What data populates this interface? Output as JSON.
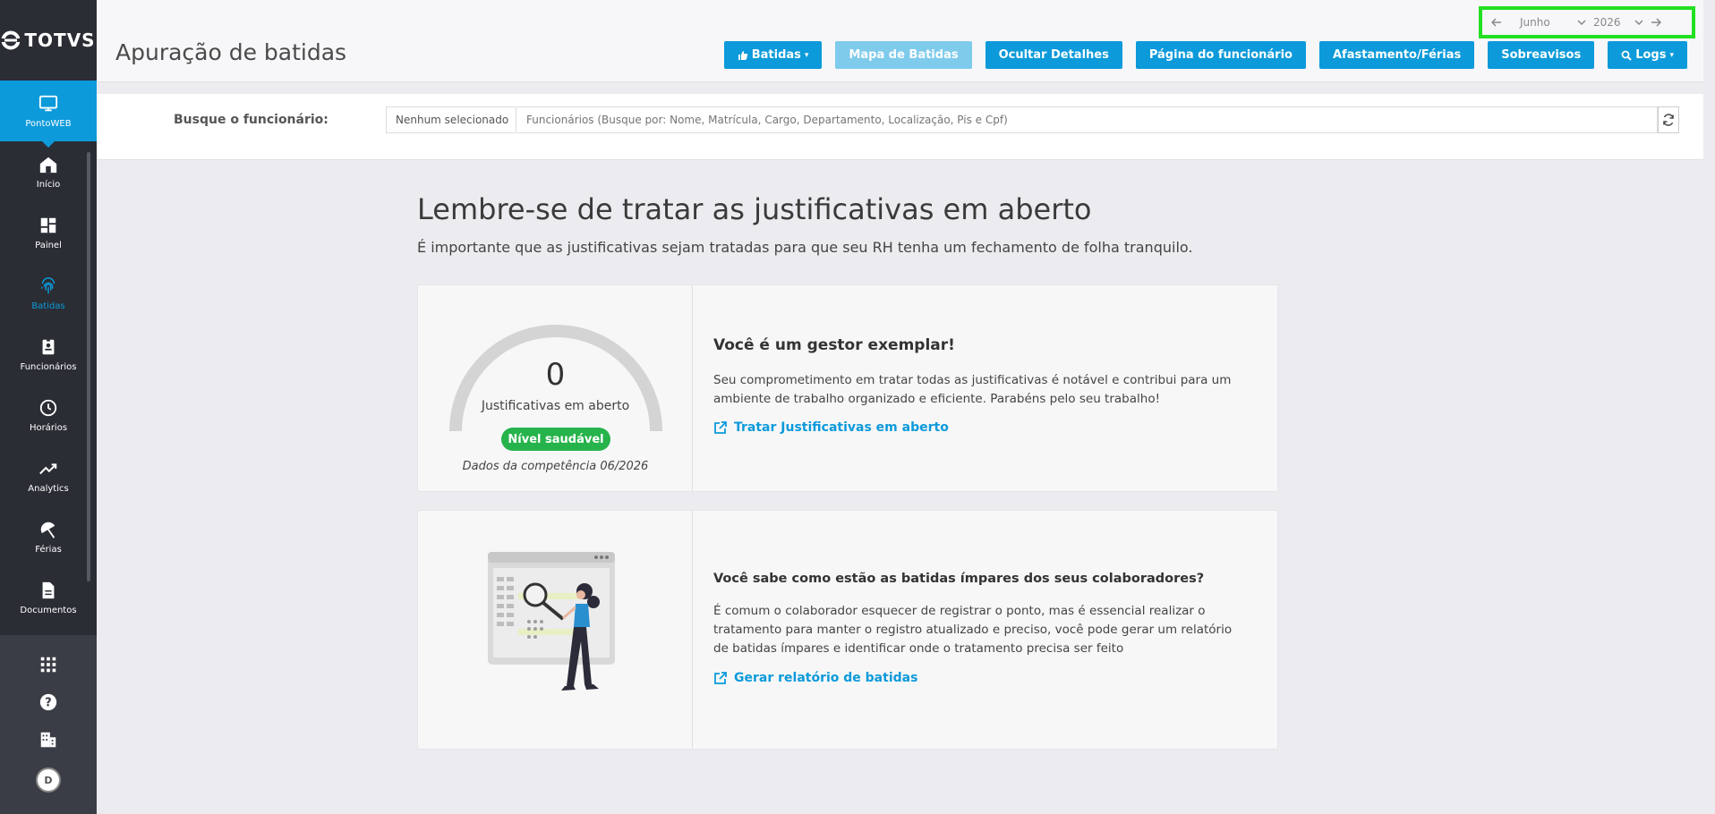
{
  "brand": {
    "name": "TOTVS"
  },
  "sidebar": {
    "items": [
      {
        "label": "PontoWEB",
        "icon": "monitor-icon"
      },
      {
        "label": "Início",
        "icon": "home-icon"
      },
      {
        "label": "Painel",
        "icon": "dashboard-icon"
      },
      {
        "label": "Batidas",
        "icon": "fingerprint-icon"
      },
      {
        "label": "Funcionários",
        "icon": "badge-icon"
      },
      {
        "label": "Horários",
        "icon": "clock-icon"
      },
      {
        "label": "Analytics",
        "icon": "trend-icon"
      },
      {
        "label": "Férias",
        "icon": "umbrella-icon"
      },
      {
        "label": "Documentos",
        "icon": "document-icon"
      }
    ],
    "avatar_initial": "D"
  },
  "header": {
    "title": "Apuração de batidas",
    "period": {
      "month": "Junho",
      "year": "2026"
    },
    "buttons": {
      "batidas": "Batidas",
      "mapa": "Mapa de Batidas",
      "ocultar": "Ocultar Detalhes",
      "pagina": "Página do funcionário",
      "afastamento": "Afastamento/Férias",
      "sobreavisos": "Sobreavisos",
      "logs": "Logs"
    }
  },
  "search": {
    "label": "Busque o funcionário:",
    "selected": "Nenhum selecionado",
    "placeholder": "Funcionários (Busque por: Nome, Matrícula, Cargo, Departamento, Localização, Pis e Cpf)"
  },
  "main": {
    "heading": "Lembre-se de tratar as justificativas em aberto",
    "subheading": "É importante que as justificativas sejam tratadas para que seu RH tenha um fechamento de folha tranquilo."
  },
  "card1": {
    "count": "0",
    "count_label": "Justificativas em aberto",
    "badge": "Nível saudável",
    "competencia": "Dados da competência 06/2026",
    "title": "Você é um gestor exemplar!",
    "text": "Seu comprometimento em tratar todas as justificativas é notável e contribui para um ambiente de trabalho organizado e eficiente. Parabéns pelo seu trabalho!",
    "link": "Tratar Justificativas em aberto"
  },
  "card2": {
    "title": "Você sabe como estão as batidas ímpares dos seus colaboradores?",
    "text": "É comum o colaborador esquecer de registrar o ponto, mas é essencial realizar o tratamento para manter o registro atualizado e preciso, você pode gerar um relatório de batidas ímpares e identificar onde o tratamento precisa ser feito",
    "link": "Gerar relatório de batidas"
  },
  "colors": {
    "accent": "#0c9ada",
    "success": "#27b34b",
    "sidebar": "#2a2d34"
  }
}
